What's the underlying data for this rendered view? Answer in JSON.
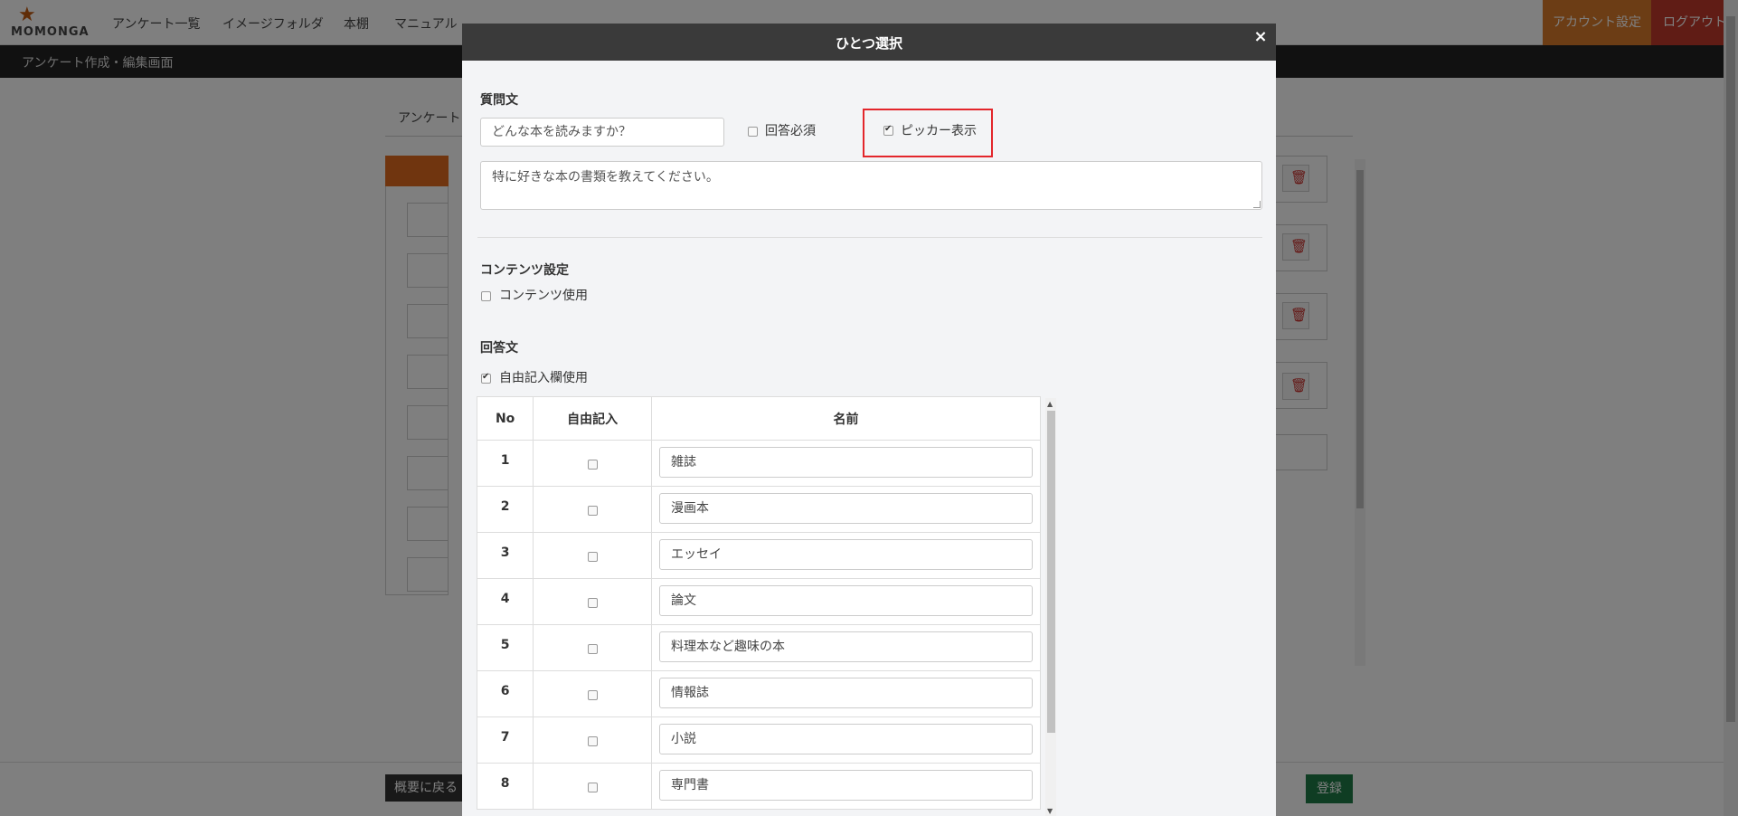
{
  "app": {
    "logo_text": "MOMONGA",
    "nav": [
      "アンケート一覧",
      "イメージフォルダ",
      "本棚",
      "マニュアル"
    ],
    "account_label": "アカウント設定",
    "logout_label": "ログアウト",
    "subtitle": "アンケート作成・編集画面",
    "tab_label": "アンケート",
    "back_label": "概要に戻る",
    "register_label": "登録",
    "colors": {
      "account": "#d97a2a",
      "logout": "#c0392b",
      "register": "#1e7b46"
    }
  },
  "modal": {
    "title": "ひとつ選択",
    "close_label": "×",
    "question_label": "質問文",
    "question_value": "どんな本を読みますか？",
    "required_label": "回答必須",
    "required_checked": false,
    "picker_label": "ピッカー表示",
    "picker_checked": true,
    "description_value": "特に好きな本の書類を教えてください。",
    "content_settings_label": "コンテンツ設定",
    "content_use_label": "コンテンツ使用",
    "content_use_checked": false,
    "answers_label": "回答文",
    "free_entry_label": "自由記入欄使用",
    "free_entry_checked": true,
    "table": {
      "headers": [
        "No",
        "自由記入",
        "名前"
      ],
      "rows": [
        {
          "no": "1",
          "free": false,
          "name": "雑誌"
        },
        {
          "no": "2",
          "free": false,
          "name": "漫画本"
        },
        {
          "no": "3",
          "free": false,
          "name": "エッセイ"
        },
        {
          "no": "4",
          "free": false,
          "name": "論文"
        },
        {
          "no": "5",
          "free": false,
          "name": "料理本など趣味の本"
        },
        {
          "no": "6",
          "free": false,
          "name": "情報誌"
        },
        {
          "no": "7",
          "free": false,
          "name": "小説"
        },
        {
          "no": "8",
          "free": false,
          "name": "専門書"
        }
      ]
    }
  }
}
